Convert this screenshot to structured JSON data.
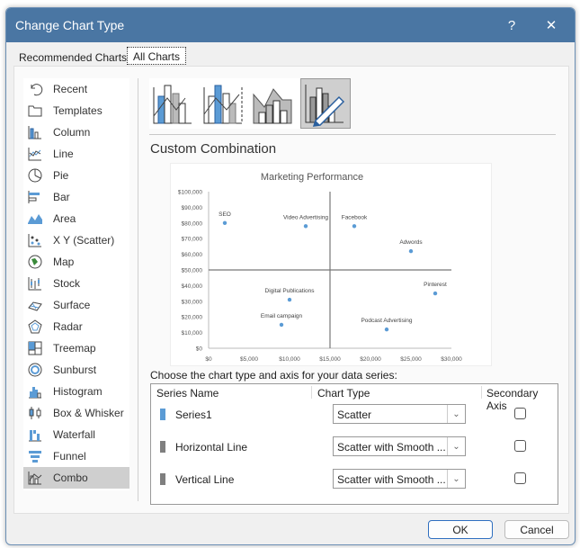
{
  "window": {
    "title": "Change Chart Type",
    "help_label": "?",
    "close_label": "✕"
  },
  "tabs": [
    {
      "label": "Recommended Charts",
      "active": false
    },
    {
      "label": "All Charts",
      "active": true
    }
  ],
  "sidebar": {
    "items": [
      {
        "label": "Recent",
        "icon": "recent-icon"
      },
      {
        "label": "Templates",
        "icon": "folder-icon"
      },
      {
        "label": "Column",
        "icon": "column-chart-icon"
      },
      {
        "label": "Line",
        "icon": "line-chart-icon"
      },
      {
        "label": "Pie",
        "icon": "pie-chart-icon"
      },
      {
        "label": "Bar",
        "icon": "bar-chart-icon"
      },
      {
        "label": "Area",
        "icon": "area-chart-icon"
      },
      {
        "label": "X Y (Scatter)",
        "icon": "scatter-chart-icon"
      },
      {
        "label": "Map",
        "icon": "map-chart-icon"
      },
      {
        "label": "Stock",
        "icon": "stock-chart-icon"
      },
      {
        "label": "Surface",
        "icon": "surface-chart-icon"
      },
      {
        "label": "Radar",
        "icon": "radar-chart-icon"
      },
      {
        "label": "Treemap",
        "icon": "treemap-chart-icon"
      },
      {
        "label": "Sunburst",
        "icon": "sunburst-chart-icon"
      },
      {
        "label": "Histogram",
        "icon": "histogram-chart-icon"
      },
      {
        "label": "Box & Whisker",
        "icon": "box-whisker-chart-icon"
      },
      {
        "label": "Waterfall",
        "icon": "waterfall-chart-icon"
      },
      {
        "label": "Funnel",
        "icon": "funnel-chart-icon"
      },
      {
        "label": "Combo",
        "icon": "combo-chart-icon",
        "selected": true
      }
    ]
  },
  "subtypes": [
    {
      "name": "clustered-column-line",
      "selected": false
    },
    {
      "name": "clustered-column-line-secondary-axis",
      "selected": false
    },
    {
      "name": "stacked-area-clustered-column",
      "selected": false
    },
    {
      "name": "custom-combination",
      "selected": true
    }
  ],
  "main": {
    "subtype_title": "Custom Combination",
    "choose_label": "Choose the chart type and axis for your data series:"
  },
  "series_table": {
    "headers": [
      "Series Name",
      "Chart Type",
      "Secondary Axis"
    ],
    "rows": [
      {
        "name": "Series1",
        "color": "#5b9bd5",
        "chart_type": "Scatter",
        "secondary": false
      },
      {
        "name": "Horizontal Line",
        "color": "#7f7f7f",
        "chart_type": "Scatter with Smooth ...",
        "secondary": false
      },
      {
        "name": "Vertical Line",
        "color": "#7f7f7f",
        "chart_type": "Scatter with Smooth ...",
        "secondary": false
      }
    ]
  },
  "buttons": {
    "ok": "OK",
    "cancel": "Cancel"
  },
  "chart_data": {
    "type": "scatter",
    "title": "Marketing Performance",
    "xlim": [
      0,
      30000
    ],
    "ylim": [
      0,
      100000
    ],
    "x_ticks": [
      "$0",
      "$5,000",
      "$10,000",
      "$15,000",
      "$20,000",
      "$25,000",
      "$30,000"
    ],
    "y_ticks": [
      "$0",
      "$10,000",
      "$20,000",
      "$30,000",
      "$40,000",
      "$50,000",
      "$60,000",
      "$70,000",
      "$80,000",
      "$90,000",
      "$100,000"
    ],
    "point_color": "#5b9bd5",
    "points": [
      {
        "label": "SEO",
        "x": 2000,
        "y": 80000
      },
      {
        "label": "Video Advertising",
        "x": 12000,
        "y": 78000
      },
      {
        "label": "Facebook",
        "x": 18000,
        "y": 78000
      },
      {
        "label": "Adwords",
        "x": 25000,
        "y": 62000
      },
      {
        "label": "Pinterest",
        "x": 28000,
        "y": 35000
      },
      {
        "label": "Digital Publications",
        "x": 10000,
        "y": 31000
      },
      {
        "label": "Email campaign",
        "x": 9000,
        "y": 15000
      },
      {
        "label": "Podcast Advertising",
        "x": 22000,
        "y": 12000
      }
    ],
    "horizontal_line_y": 50000,
    "vertical_line_x": 15000,
    "grid": false
  }
}
